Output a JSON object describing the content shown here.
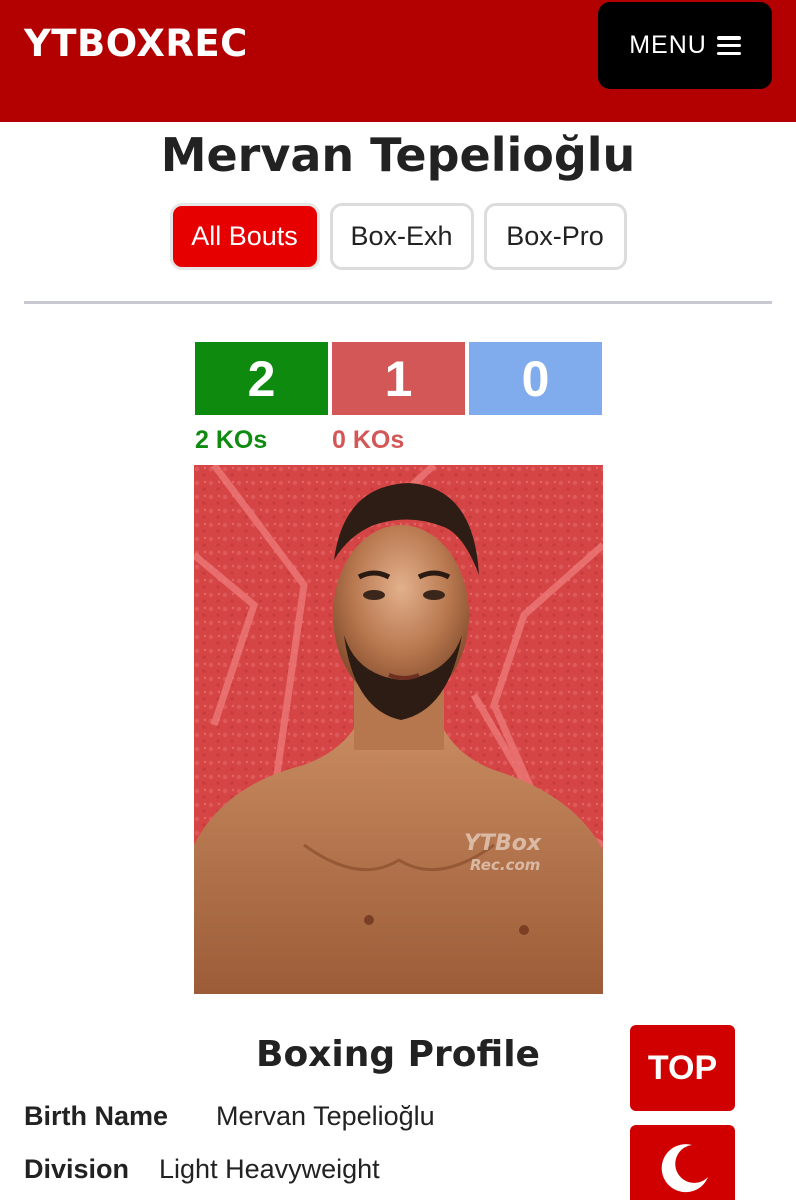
{
  "header": {
    "brand": "YTBOXREC",
    "menu_label": "MENU",
    "menu_icon": "hamburger-icon"
  },
  "fighter": {
    "name": "Mervan Tepelioğlu"
  },
  "tabs": [
    {
      "label": "All Bouts",
      "active": true
    },
    {
      "label": "Box-Exh",
      "active": false
    },
    {
      "label": "Box-Pro",
      "active": false
    }
  ],
  "record": {
    "wins": "2",
    "losses": "1",
    "draws": "0",
    "win_kos": "2 KOs",
    "loss_kos": "0 KOs",
    "colors": {
      "win": "#0e8a0e",
      "loss": "#d35757",
      "draw": "#80acee"
    }
  },
  "photo": {
    "watermark_line1": "YTBox",
    "watermark_line2": "Rec.com"
  },
  "profile": {
    "title": "Boxing Profile",
    "rows": [
      {
        "label": "Birth Name",
        "value": "Mervan Tepelioğlu"
      },
      {
        "label": "Division",
        "value": "Light Heavyweight"
      }
    ]
  },
  "floating": {
    "top_label": "TOP",
    "theme_icon": "moon-icon"
  },
  "colors": {
    "brand_red": "#b30000",
    "accent_red": "#e60000"
  }
}
